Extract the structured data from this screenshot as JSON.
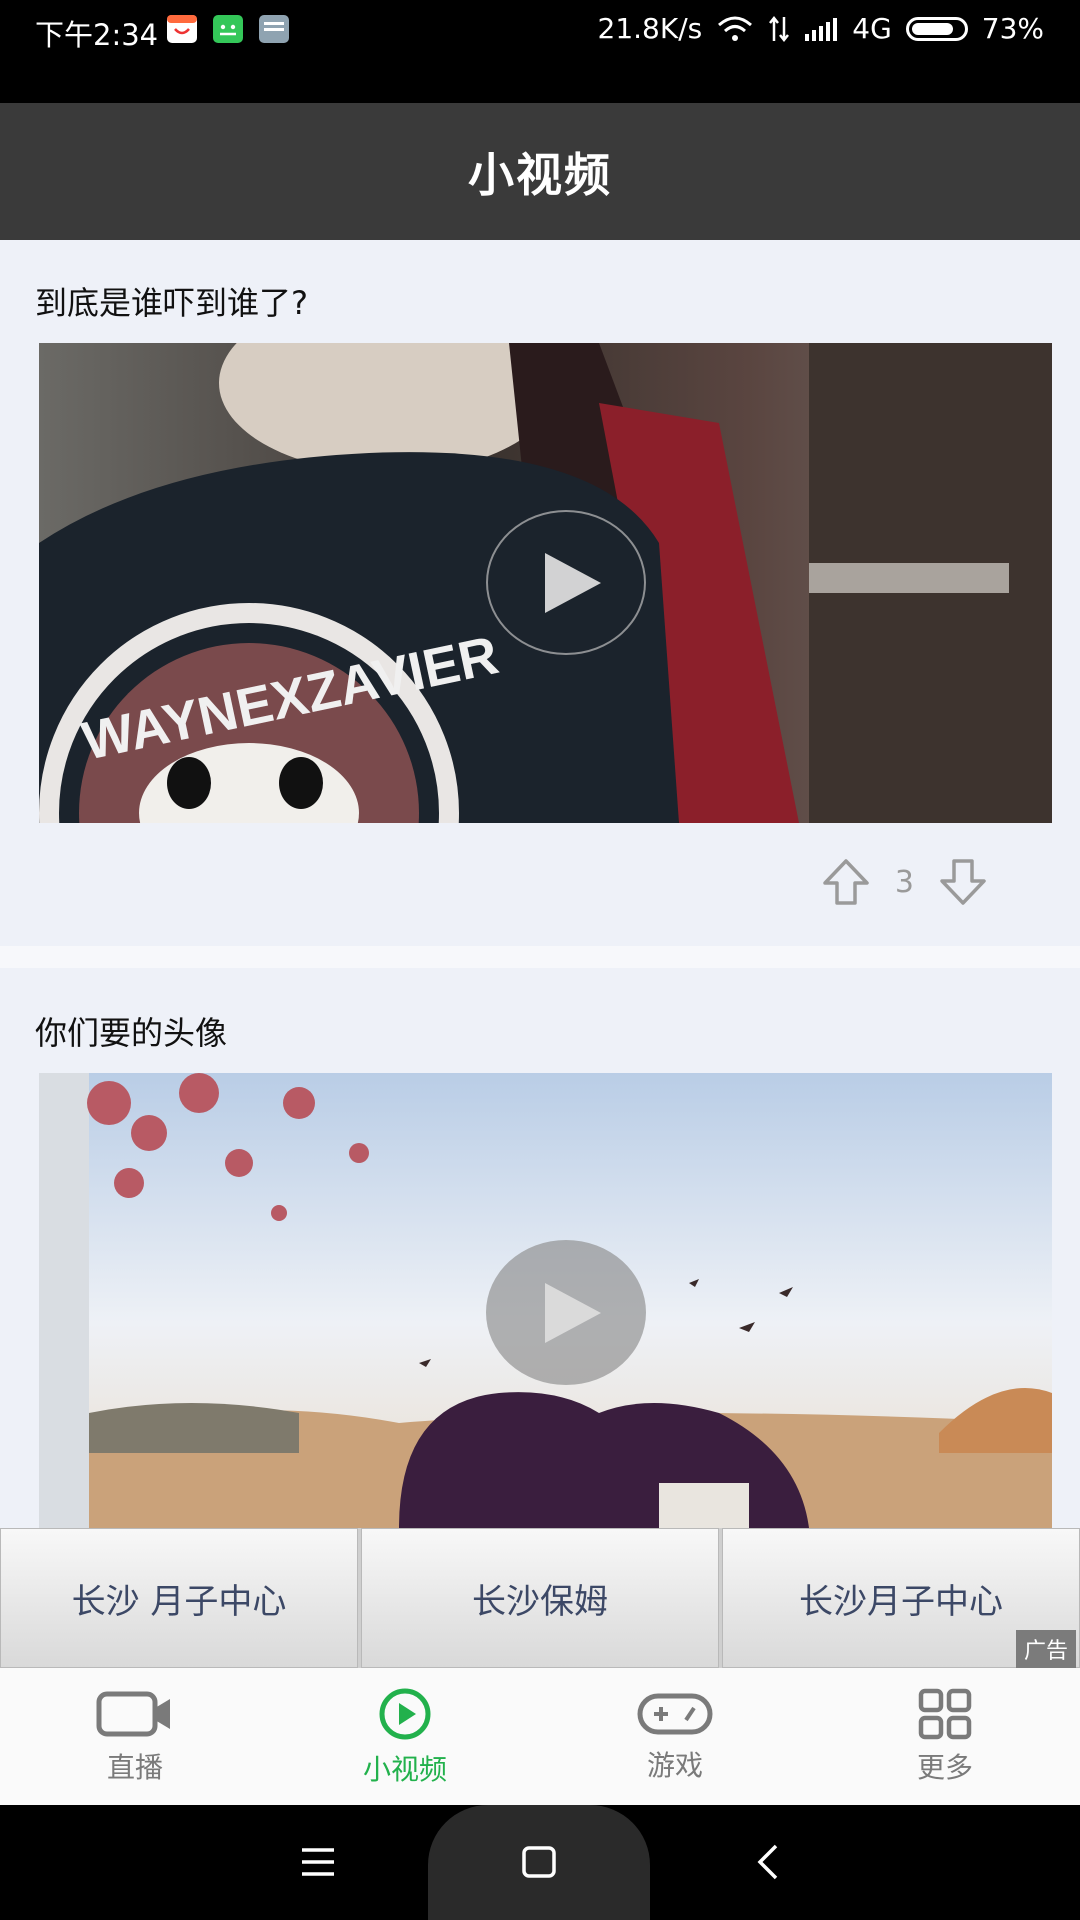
{
  "status_bar": {
    "time": "下午2:34",
    "net_speed": "21.8K/s",
    "network": "4G",
    "battery": "73%",
    "app_icons": [
      {
        "name": "calendar-app-icon",
        "color": "#ffffff"
      },
      {
        "name": "android-app-icon",
        "color": "#34c759"
      },
      {
        "name": "notes-app-icon",
        "color": "#8fa3b1"
      }
    ],
    "icons": [
      "wifi-icon",
      "data-arrows-icon",
      "signal-icon",
      "battery-icon"
    ]
  },
  "header": {
    "title": "小视频"
  },
  "feed": {
    "items": [
      {
        "title": "到底是谁吓到谁了?",
        "vote_count": "3",
        "thumbnail_colors": [
          "#1b232c",
          "#4a3a34",
          "#8b1f2a",
          "#6d6661"
        ],
        "thumbnail_text": "WAYNEXZAVIER"
      },
      {
        "title": "你们要的头像",
        "thumbnail_colors": [
          "#dde6f2",
          "#b85a64",
          "#c89a6a",
          "#3a1e3e"
        ]
      }
    ]
  },
  "ads": {
    "buttons": [
      "长沙 月子中心",
      "长沙保姆",
      "长沙月子中心"
    ],
    "tag": "广告"
  },
  "bottom_nav": {
    "tabs": [
      {
        "label": "直播",
        "icon": "video-camera-icon",
        "active": false
      },
      {
        "label": "小视频",
        "icon": "play-circle-icon",
        "active": true
      },
      {
        "label": "游戏",
        "icon": "gamepad-icon",
        "active": false
      },
      {
        "label": "更多",
        "icon": "grid-icon",
        "active": false
      }
    ],
    "active_color": "#22b14c",
    "inactive_color": "#7a7a7a"
  },
  "system_nav": {
    "icons": [
      "menu-icon",
      "home-icon",
      "back-icon"
    ]
  }
}
